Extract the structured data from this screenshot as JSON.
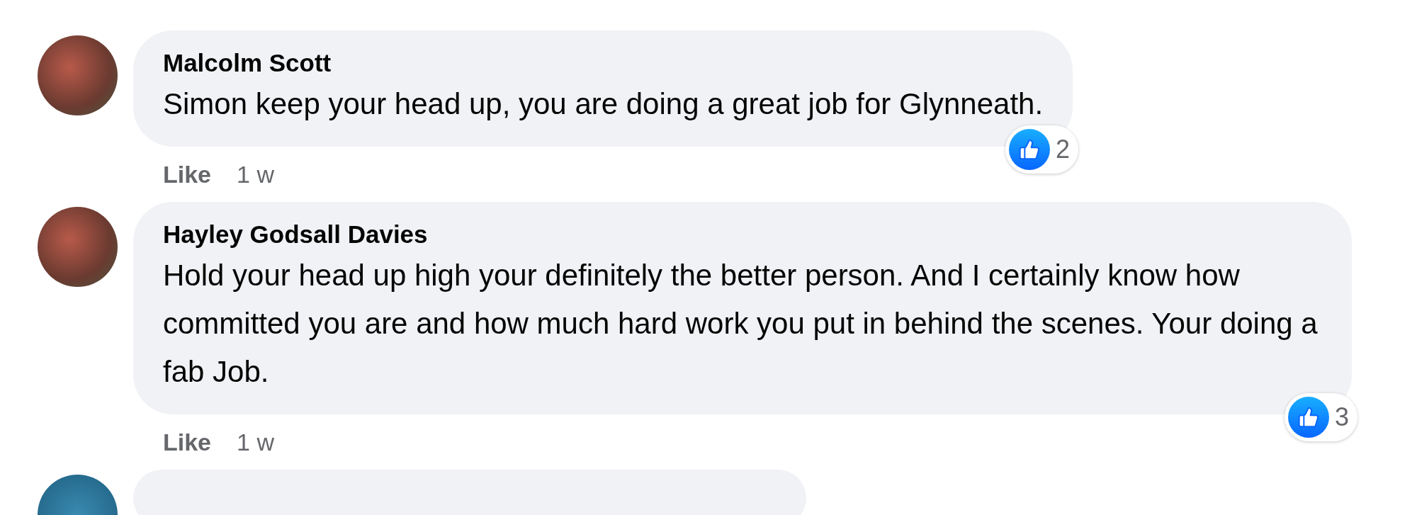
{
  "comments": [
    {
      "author": "Malcolm Scott",
      "text": "Simon keep your head up, you are doing a great job for Glynneath.",
      "reaction_count": "2",
      "like_label": "Like",
      "time": "1 w"
    },
    {
      "author": "Hayley Godsall Davies",
      "text": "Hold your head up high your definitely the better person. And I certainly know how committed you are and how much hard work you put in behind the scenes. Your doing a fab Job.",
      "reaction_count": "3",
      "like_label": "Like",
      "time": "1 w"
    }
  ]
}
